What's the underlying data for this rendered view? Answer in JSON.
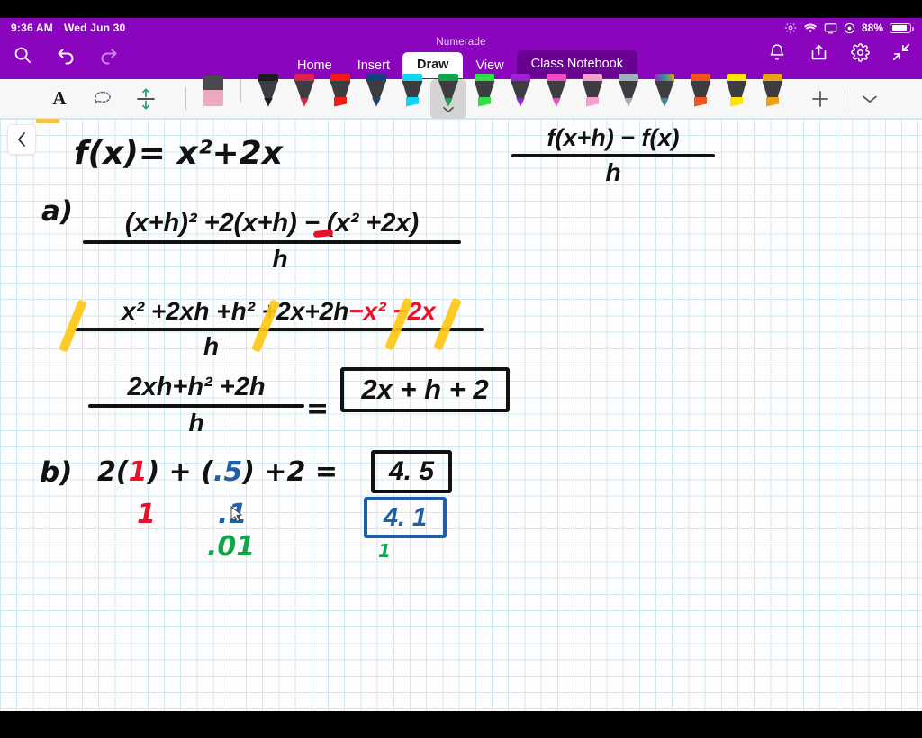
{
  "statusbar": {
    "time": "9:36 AM",
    "date": "Wed Jun 30",
    "battery_percent": "88%",
    "icons": [
      "brightness-icon",
      "wifi-icon",
      "screen-mirroring-icon",
      "location-icon",
      "battery-icon"
    ]
  },
  "ribbon": {
    "app_title": "Numerade",
    "left_icons": [
      "search-icon",
      "undo-icon",
      "redo-icon"
    ],
    "right_icons": [
      "bell-icon",
      "share-icon",
      "gear-icon",
      "collapse-icon"
    ],
    "tabs": [
      {
        "label": "Home",
        "active": false
      },
      {
        "label": "Insert",
        "active": false
      },
      {
        "label": "Draw",
        "active": true
      },
      {
        "label": "View",
        "active": false
      },
      {
        "label": "Class Notebook",
        "active": false,
        "style": "notebook"
      }
    ]
  },
  "pen_toolbar": {
    "tools": [
      {
        "name": "text-tool",
        "glyph": "A"
      },
      {
        "name": "lasso-select-tool",
        "glyph": "lasso"
      },
      {
        "name": "insert-space-tool",
        "glyph": "space"
      }
    ],
    "eraser": {
      "name": "eraser-tool",
      "color": "#eba9bd"
    },
    "pens": [
      {
        "name": "pen-black",
        "color": "#1d1d1f",
        "type": "pen",
        "selected": false
      },
      {
        "name": "pen-crimson",
        "color": "#e0224a",
        "type": "pen",
        "selected": false
      },
      {
        "name": "pen-red",
        "color": "#f01b17",
        "type": "pen",
        "selected": false
      },
      {
        "name": "pen-navy",
        "color": "#14427e",
        "type": "pen",
        "selected": false
      },
      {
        "name": "pen-cyan",
        "color": "#0fd7ef",
        "type": "pen",
        "selected": false
      },
      {
        "name": "pen-green",
        "color": "#12a44b",
        "type": "pen",
        "selected": true
      },
      {
        "name": "pen-bright-green",
        "color": "#2ee048",
        "type": "pen",
        "selected": false
      },
      {
        "name": "pen-purple",
        "color": "#a11fd6",
        "type": "pen",
        "selected": false
      },
      {
        "name": "pen-magenta",
        "color": "#ef4fc2",
        "type": "pen",
        "selected": false
      },
      {
        "name": "pen-pink",
        "color": "#f49fd0",
        "type": "pen",
        "selected": false
      },
      {
        "name": "pen-silver",
        "color": "#9fb0b8",
        "type": "pen",
        "selected": false
      },
      {
        "name": "pen-teal-gradient",
        "color": "#2f8f9b",
        "type": "pen",
        "selected": false
      },
      {
        "name": "pen-orange",
        "color": "#f0541c",
        "type": "pen",
        "selected": false
      },
      {
        "name": "highlighter-yellow",
        "color": "#ffe400",
        "type": "highlighter",
        "selected": false
      },
      {
        "name": "highlighter-gold",
        "color": "#e8a416",
        "type": "highlighter",
        "selected": false
      }
    ],
    "add_label": "+",
    "more_label": "chevron-down-icon"
  },
  "canvas": {
    "back_button": "chevron-left-icon",
    "notes": {
      "function_def": {
        "text": "f(x)= x2+2x",
        "display": "f(x)=  x²+2x"
      },
      "difference_quotient": {
        "numerator": "f(x+h) − f(x)",
        "denominator": "h"
      },
      "part_a": {
        "label": "a)",
        "step1": {
          "numerator": "(x+h)² +2(x+h)  −  (x² +2x)",
          "denominator": "h",
          "minus_sign_color": "#e8112d"
        },
        "step2": {
          "numerator": "x² +2xh +h² +2x+2h −x² −2x",
          "denominator": "h",
          "cancel_color": "#ffc715",
          "red_terms": "−x² −2x"
        },
        "step3": {
          "numerator": "2xh+h² +2h",
          "denominator": "h",
          "equals": "=",
          "answer_boxed": "2x + h + 2"
        }
      },
      "part_b": {
        "label": "b)",
        "expression": "2( 1 ) + ( .5 ) + 2  =",
        "red_one": "1",
        "answer_boxed": "4. 5",
        "blue_h_value": ".1",
        "blue_answer_boxed": "4. 1",
        "green_h_value": ".01",
        "green_tick": "1",
        "colors": {
          "red": "#e8112d",
          "blue": "#1f5fa8",
          "green": "#12a44b",
          "black": "#111111"
        }
      }
    },
    "pointer": "mouse-cursor"
  }
}
